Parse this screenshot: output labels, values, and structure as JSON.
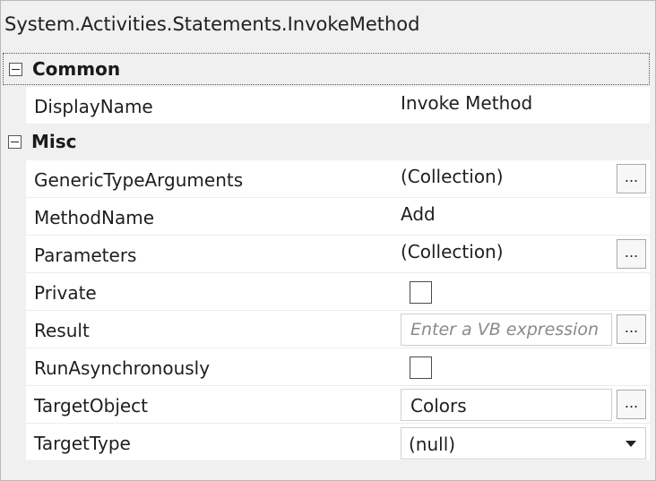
{
  "title": "System.Activities.Statements.InvokeMethod",
  "categories": {
    "common": "Common",
    "misc": "Misc"
  },
  "properties": {
    "display_name": {
      "name": "DisplayName",
      "value": "Invoke Method"
    },
    "generic_type_arguments": {
      "name": "GenericTypeArguments",
      "value": "(Collection)",
      "button": "..."
    },
    "method_name": {
      "name": "MethodName",
      "value": "Add"
    },
    "parameters": {
      "name": "Parameters",
      "value": "(Collection)",
      "button": "..."
    },
    "private": {
      "name": "Private",
      "checked": false
    },
    "result": {
      "name": "Result",
      "placeholder": "Enter a VB expression",
      "button": "..."
    },
    "run_asynchronously": {
      "name": "RunAsynchronously",
      "checked": false
    },
    "target_object": {
      "name": "TargetObject",
      "value": "Colors",
      "button": "..."
    },
    "target_type": {
      "name": "TargetType",
      "value": "(null)"
    }
  },
  "icons": {
    "expander": "collapse-minus-icon",
    "dropdown": "chevron-down-icon"
  }
}
